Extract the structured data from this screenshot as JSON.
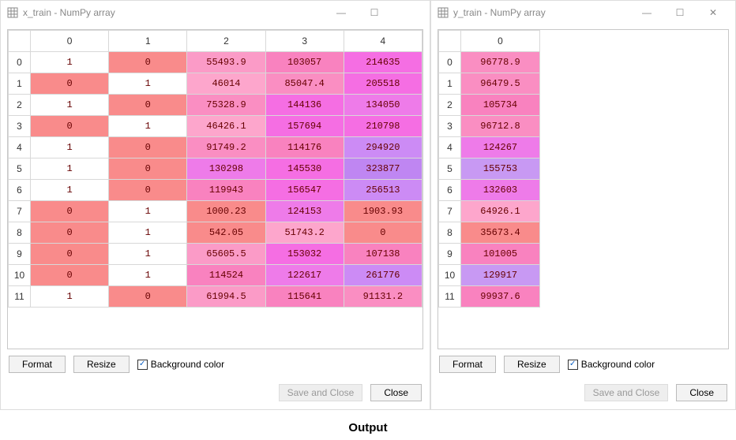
{
  "left": {
    "title": "x_train - NumPy array",
    "cols": [
      "0",
      "1",
      "2",
      "3",
      "4"
    ],
    "rows": [
      {
        "idx": "0",
        "cells": [
          {
            "v": "1",
            "c": "c-white"
          },
          {
            "v": "0",
            "c": "c-salmon"
          },
          {
            "v": "55493.9",
            "c": "c-pink1"
          },
          {
            "v": "103057",
            "c": "c-pink3"
          },
          {
            "v": "214635",
            "c": "c-mag1"
          }
        ]
      },
      {
        "idx": "1",
        "cells": [
          {
            "v": "0",
            "c": "c-salmon"
          },
          {
            "v": "1",
            "c": "c-white"
          },
          {
            "v": "46014",
            "c": "c-pink0"
          },
          {
            "v": "85047.4",
            "c": "c-pink2"
          },
          {
            "v": "205518",
            "c": "c-mag1"
          }
        ]
      },
      {
        "idx": "2",
        "cells": [
          {
            "v": "1",
            "c": "c-white"
          },
          {
            "v": "0",
            "c": "c-salmon"
          },
          {
            "v": "75328.9",
            "c": "c-pink2"
          },
          {
            "v": "144136",
            "c": "c-mag1"
          },
          {
            "v": "134050",
            "c": "c-mag2"
          }
        ]
      },
      {
        "idx": "3",
        "cells": [
          {
            "v": "0",
            "c": "c-salmon"
          },
          {
            "v": "1",
            "c": "c-white"
          },
          {
            "v": "46426.1",
            "c": "c-pink0"
          },
          {
            "v": "157694",
            "c": "c-mag1"
          },
          {
            "v": "210798",
            "c": "c-mag1"
          }
        ]
      },
      {
        "idx": "4",
        "cells": [
          {
            "v": "1",
            "c": "c-white"
          },
          {
            "v": "0",
            "c": "c-salmon"
          },
          {
            "v": "91749.2",
            "c": "c-pink2"
          },
          {
            "v": "114176",
            "c": "c-pink3"
          },
          {
            "v": "294920",
            "c": "c-purp1"
          }
        ]
      },
      {
        "idx": "5",
        "cells": [
          {
            "v": "1",
            "c": "c-white"
          },
          {
            "v": "0",
            "c": "c-salmon"
          },
          {
            "v": "130298",
            "c": "c-mag2"
          },
          {
            "v": "145530",
            "c": "c-mag1"
          },
          {
            "v": "323877",
            "c": "c-purp2"
          }
        ]
      },
      {
        "idx": "6",
        "cells": [
          {
            "v": "1",
            "c": "c-white"
          },
          {
            "v": "0",
            "c": "c-salmon"
          },
          {
            "v": "119943",
            "c": "c-pink3"
          },
          {
            "v": "156547",
            "c": "c-mag1"
          },
          {
            "v": "256513",
            "c": "c-purp1"
          }
        ]
      },
      {
        "idx": "7",
        "cells": [
          {
            "v": "0",
            "c": "c-salmon"
          },
          {
            "v": "1",
            "c": "c-white"
          },
          {
            "v": "1000.23",
            "c": "c-salmon"
          },
          {
            "v": "124153",
            "c": "c-mag2"
          },
          {
            "v": "1903.93",
            "c": "c-salmon"
          }
        ]
      },
      {
        "idx": "8",
        "cells": [
          {
            "v": "0",
            "c": "c-salmon"
          },
          {
            "v": "1",
            "c": "c-white"
          },
          {
            "v": "542.05",
            "c": "c-salmon"
          },
          {
            "v": "51743.2",
            "c": "c-pink0"
          },
          {
            "v": "0",
            "c": "c-salmon"
          }
        ]
      },
      {
        "idx": "9",
        "cells": [
          {
            "v": "0",
            "c": "c-salmon"
          },
          {
            "v": "1",
            "c": "c-white"
          },
          {
            "v": "65605.5",
            "c": "c-pink1"
          },
          {
            "v": "153032",
            "c": "c-mag1"
          },
          {
            "v": "107138",
            "c": "c-pink3"
          }
        ]
      },
      {
        "idx": "10",
        "cells": [
          {
            "v": "0",
            "c": "c-salmon"
          },
          {
            "v": "1",
            "c": "c-white"
          },
          {
            "v": "114524",
            "c": "c-pink3"
          },
          {
            "v": "122617",
            "c": "c-mag2"
          },
          {
            "v": "261776",
            "c": "c-purp1"
          }
        ]
      },
      {
        "idx": "11",
        "cells": [
          {
            "v": "1",
            "c": "c-white"
          },
          {
            "v": "0",
            "c": "c-salmon"
          },
          {
            "v": "61994.5",
            "c": "c-pink1"
          },
          {
            "v": "115641",
            "c": "c-pink3"
          },
          {
            "v": "91131.2",
            "c": "c-pink2"
          }
        ]
      }
    ],
    "format": "Format",
    "resize": "Resize",
    "bg": "Background color",
    "save": "Save and Close",
    "close": "Close"
  },
  "right": {
    "title": "y_train - NumPy array",
    "cols": [
      "0"
    ],
    "rows": [
      {
        "idx": "0",
        "cells": [
          {
            "v": "96778.9",
            "c": "c-pink2"
          }
        ]
      },
      {
        "idx": "1",
        "cells": [
          {
            "v": "96479.5",
            "c": "c-pink2"
          }
        ]
      },
      {
        "idx": "2",
        "cells": [
          {
            "v": "105734",
            "c": "c-pink3"
          }
        ]
      },
      {
        "idx": "3",
        "cells": [
          {
            "v": "96712.8",
            "c": "c-pink2"
          }
        ]
      },
      {
        "idx": "4",
        "cells": [
          {
            "v": "124267",
            "c": "c-mag2"
          }
        ]
      },
      {
        "idx": "5",
        "cells": [
          {
            "v": "155753",
            "c": "c-purp3"
          }
        ]
      },
      {
        "idx": "6",
        "cells": [
          {
            "v": "132603",
            "c": "c-mag2"
          }
        ]
      },
      {
        "idx": "7",
        "cells": [
          {
            "v": "64926.1",
            "c": "c-pink0"
          }
        ]
      },
      {
        "idx": "8",
        "cells": [
          {
            "v": "35673.4",
            "c": "c-salmon"
          }
        ]
      },
      {
        "idx": "9",
        "cells": [
          {
            "v": "101005",
            "c": "c-pink3"
          }
        ]
      },
      {
        "idx": "10",
        "cells": [
          {
            "v": "129917",
            "c": "c-purp3"
          }
        ]
      },
      {
        "idx": "11",
        "cells": [
          {
            "v": "99937.6",
            "c": "c-pink3"
          }
        ]
      }
    ],
    "format": "Format",
    "resize": "Resize",
    "bg": "Background color",
    "save": "Save and Close",
    "close": "Close"
  },
  "output": "Output"
}
